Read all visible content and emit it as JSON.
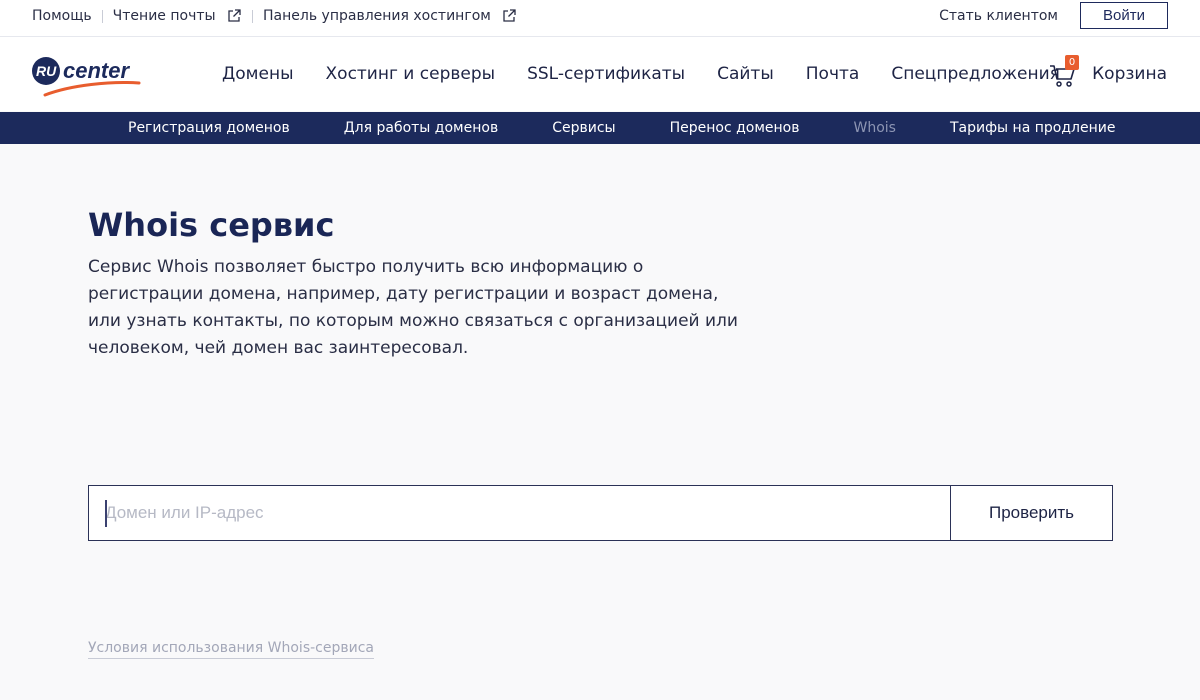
{
  "topbar": {
    "help": "Помощь",
    "mail": "Чтение почты",
    "hosting_panel": "Панель управления хостингом",
    "become_client": "Стать клиентом",
    "login": "Войти"
  },
  "logo": {
    "prefix": "RU",
    "name": "center"
  },
  "mainnav": {
    "items": [
      "Домены",
      "Хостинг и серверы",
      "SSL-сертификаты",
      "Сайты",
      "Почта",
      "Спецпредложения"
    ]
  },
  "cart": {
    "count": "0",
    "label": "Корзина"
  },
  "subnav": {
    "items": [
      "Регистрация доменов",
      "Для работы доменов",
      "Сервисы",
      "Перенос доменов",
      "Whois",
      "Тарифы на продление"
    ],
    "active": "Whois"
  },
  "content": {
    "title": "Whois сервис",
    "description": "Сервис Whois позволяет быстро получить всю информацию о регистрации домена, например, дату регистрации и возраст домена, или узнать контакты, по которым можно связаться с организацией или человеком, чей домен вас заинтересовал."
  },
  "search": {
    "value": "",
    "placeholder": "Домен или IP-адрес",
    "button": "Проверить"
  },
  "footer": {
    "terms_link": "Условия использования Whois-сервиса"
  },
  "colors": {
    "brand_navy": "#1c2a5c",
    "accent_orange": "#e85d2e",
    "background": "#f9f9fa"
  }
}
